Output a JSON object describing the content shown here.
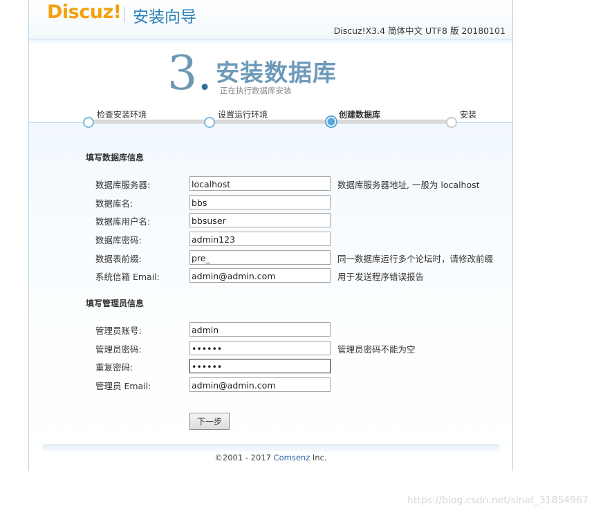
{
  "header": {
    "logo": "Discuz!",
    "wizard_title": "安装向导",
    "version": "Discuz!X3.4 简体中文 UTF8 版 20180101"
  },
  "step": {
    "number": "3",
    "dot": ".",
    "title": "安装数据库",
    "subtitle": "正在执行数据库安装"
  },
  "progress": {
    "steps": [
      {
        "label": "检查安装环境",
        "state": "done"
      },
      {
        "label": "设置运行环境",
        "state": "done"
      },
      {
        "label": "创建数据库",
        "state": "active"
      },
      {
        "label": "安装",
        "state": "todo"
      }
    ]
  },
  "db_section": {
    "title": "填写数据库信息",
    "fields": [
      {
        "label": "数据库服务器:",
        "value": "localhost",
        "hint": "数据库服务器地址, 一般为 localhost"
      },
      {
        "label": "数据库名:",
        "value": "bbs",
        "hint": ""
      },
      {
        "label": "数据库用户名:",
        "value": "bbsuser",
        "hint": ""
      },
      {
        "label": "数据库密码:",
        "value": "admin123",
        "hint": ""
      },
      {
        "label": "数据表前缀:",
        "value": "pre_",
        "hint": "同一数据库运行多个论坛时，请修改前缀"
      },
      {
        "label": "系统信箱 Email:",
        "value": "admin@admin.com",
        "hint": "用于发送程序错误报告"
      }
    ]
  },
  "admin_section": {
    "title": "填写管理员信息",
    "fields": [
      {
        "label": "管理员账号:",
        "value": "admin",
        "hint": ""
      },
      {
        "label": "管理员密码:",
        "value": "••••••",
        "hint": "管理员密码不能为空"
      },
      {
        "label": "重复密码:",
        "value": "••••••",
        "hint": ""
      },
      {
        "label": "管理员 Email:",
        "value": "admin@admin.com",
        "hint": ""
      }
    ]
  },
  "next_button": "下一步",
  "footer": {
    "copyright": "©2001 - 2017 ",
    "company": "Comsenz",
    "suffix": " Inc."
  },
  "watermark": "https://blog.csdn.net/sinat_31854967"
}
